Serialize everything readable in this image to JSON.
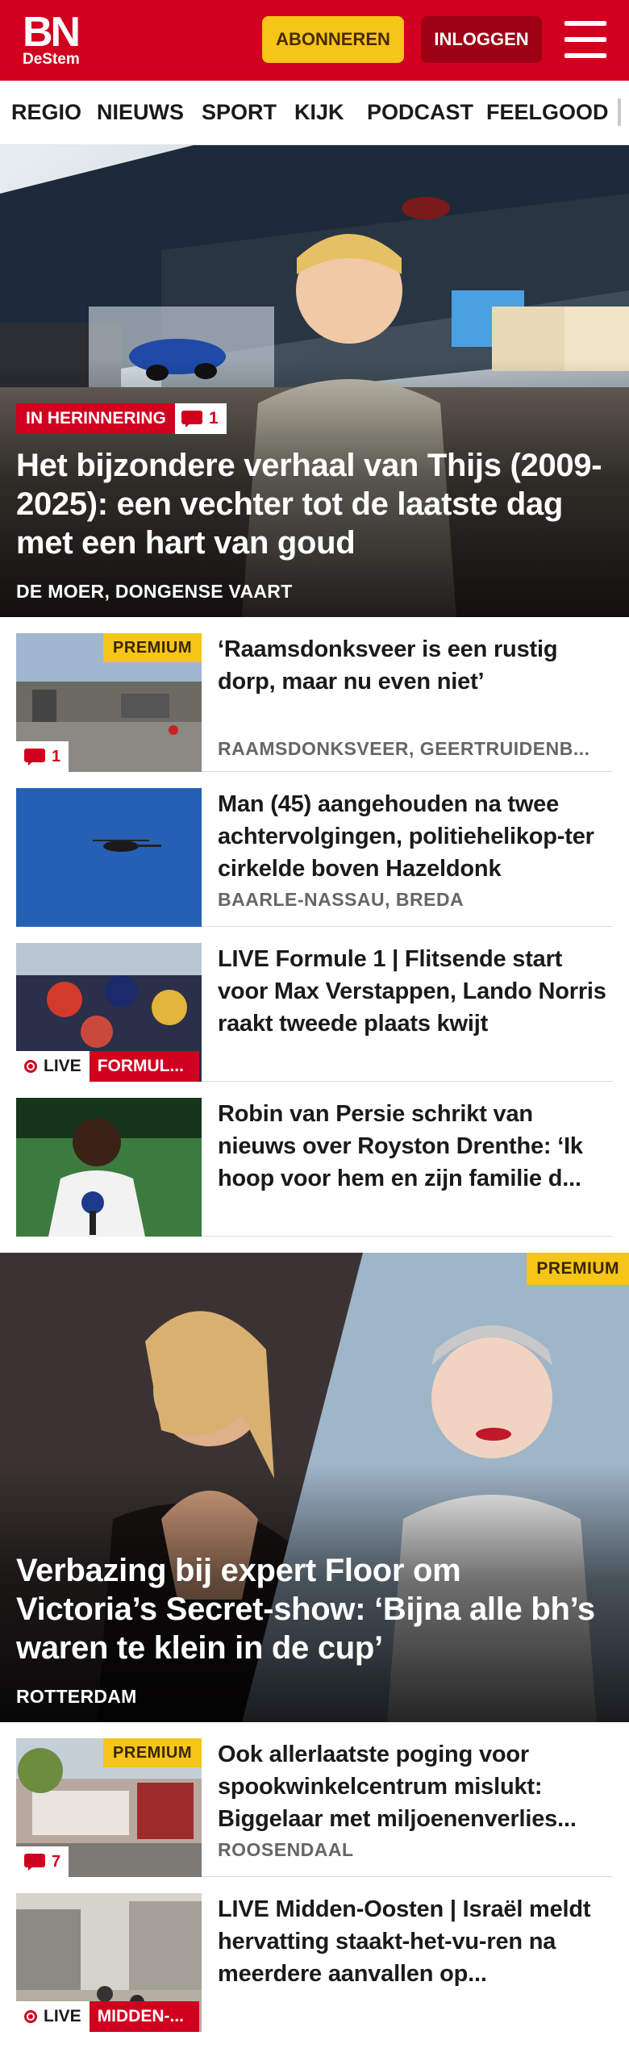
{
  "header": {
    "logo_main": "BN",
    "logo_sub": "DeStem",
    "subscribe_label": "ABONNEREN",
    "login_label": "INLOGGEN"
  },
  "nav": {
    "items": [
      "REGIO",
      "NIEUWS",
      "SPORT",
      "KIJK",
      "PODCAST",
      "FEELGOOD"
    ]
  },
  "hero1": {
    "tag": "IN HERINNERING",
    "comments": "1",
    "title": "Het bijzondere verhaal van Thijs (2009-2025): een vechter tot de laatste dag met een hart van goud",
    "location": "DE MOER, DONGENSE VAART"
  },
  "articles1": [
    {
      "title": "‘Raamsdonksveer is een rustig dorp, maar nu even niet’",
      "location": "RAAMSDONKSVEER, GEERTRUIDENB...",
      "premium": "PREMIUM",
      "comments": "1"
    },
    {
      "title": "Man (45) aangehouden na twee achtervolgingen, politiehelikop-ter cirkelde boven Hazeldonk",
      "location": "BAARLE-NASSAU, BREDA"
    },
    {
      "title": "LIVE Formule 1 | Flitsende start voor Max Verstappen, Lando Norris raakt tweede plaats kwijt",
      "live": "LIVE",
      "topic": "FORMUL..."
    },
    {
      "title": "Robin van Persie schrikt van nieuws over Royston Drenthe: ‘Ik hoop voor hem en zijn familie d..."
    }
  ],
  "hero2": {
    "premium": "PREMIUM",
    "title": "Verbazing bij expert Floor om Victoria’s Secret-show: ‘Bijna alle bh’s waren te klein in de cup’",
    "location": "ROTTERDAM"
  },
  "articles2": [
    {
      "title": "Ook allerlaatste poging voor spookwinkelcentrum mislukt: Biggelaar met miljoenenverlies...",
      "location": "ROOSENDAAL",
      "premium": "PREMIUM",
      "comments": "7"
    },
    {
      "title": "LIVE Midden-Oosten | Israël meldt hervatting staakt-het-vu-ren na meerdere aanvallen op...",
      "live": "LIVE",
      "topic": "MIDDEN-..."
    }
  ],
  "colors": {
    "brand_red": "#d1001f",
    "premium_yellow": "#f5c518",
    "login_dark_red": "#9e0014"
  }
}
